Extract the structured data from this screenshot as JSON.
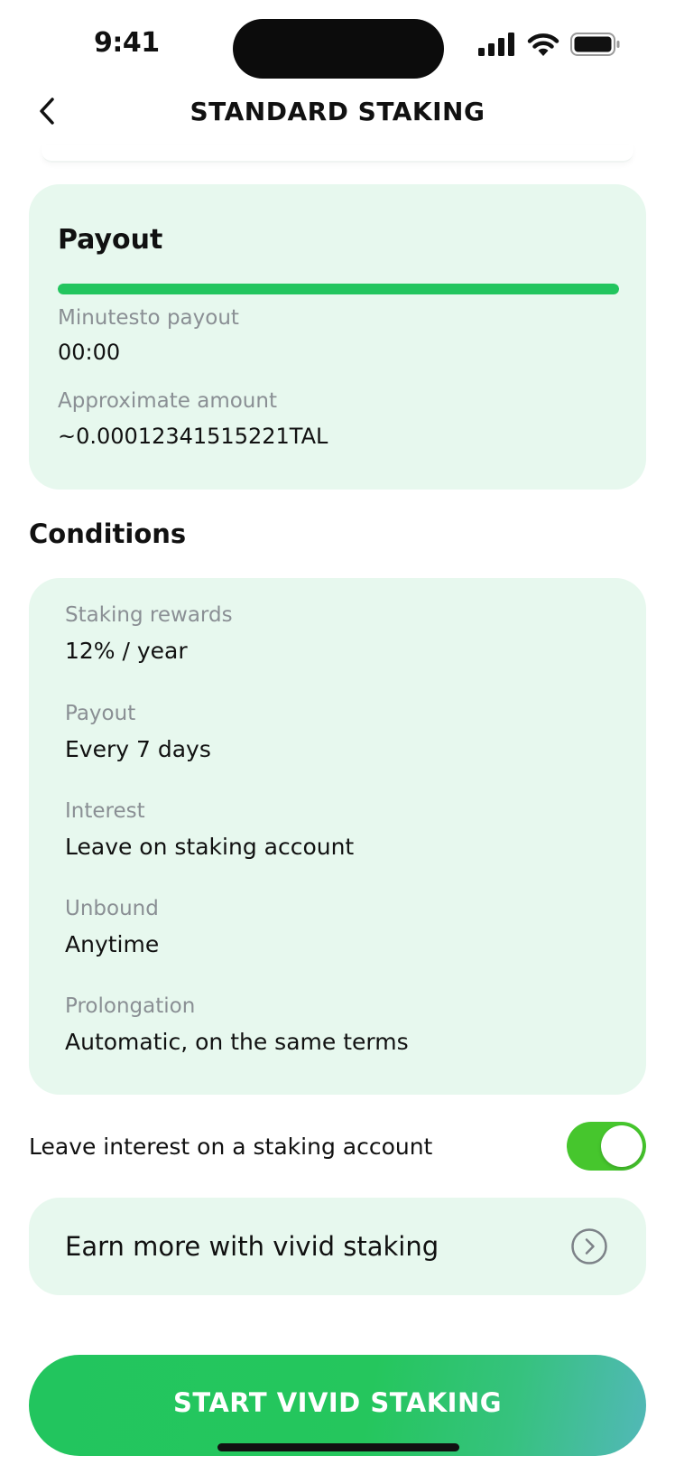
{
  "status_bar": {
    "time": "9:41"
  },
  "header": {
    "title": "STANDARD STAKING",
    "back_icon": "chevron-left-icon"
  },
  "payout": {
    "title": "Payout",
    "progress": 1.0,
    "progress_color": "#22c55e",
    "minutes_label": "Minutesto payout",
    "minutes_value": "00:00",
    "amount_label": "Approximate amount",
    "amount_value": "~0.00012341515221TAL"
  },
  "conditions": {
    "title": "Conditions",
    "items": [
      {
        "label": "Staking rewards",
        "value": "12% / year"
      },
      {
        "label": "Payout",
        "value": "Every 7 days"
      },
      {
        "label": "Interest",
        "value": "Leave on staking account"
      },
      {
        "label": "Unbound",
        "value": "Anytime"
      },
      {
        "label": "Prolongation",
        "value": "Automatic, on the same terms"
      }
    ]
  },
  "toggle": {
    "label": "Leave interest on a staking account",
    "enabled": true,
    "on_color": "#46c62d"
  },
  "earn_more": {
    "label": "Earn more with vivid staking",
    "icon": "chevron-right-circle-icon"
  },
  "cta": {
    "label": "START VIVID STAKING",
    "color": "#22c55e"
  },
  "colors": {
    "card_background": "#e7f8ee",
    "muted_text": "#8a8f94"
  }
}
